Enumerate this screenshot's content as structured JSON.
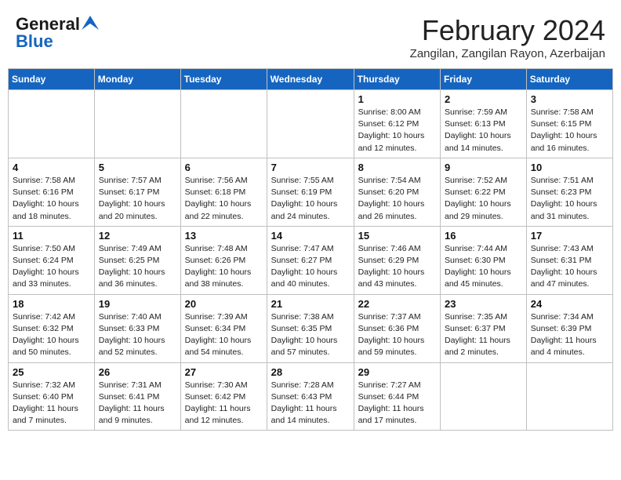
{
  "logo": {
    "line1": "General",
    "line2": "Blue"
  },
  "title": "February 2024",
  "subtitle": "Zangilan, Zangilan Rayon, Azerbaijan",
  "days_header": [
    "Sunday",
    "Monday",
    "Tuesday",
    "Wednesday",
    "Thursday",
    "Friday",
    "Saturday"
  ],
  "weeks": [
    [
      {
        "num": "",
        "info": ""
      },
      {
        "num": "",
        "info": ""
      },
      {
        "num": "",
        "info": ""
      },
      {
        "num": "",
        "info": ""
      },
      {
        "num": "1",
        "info": "Sunrise: 8:00 AM\nSunset: 6:12 PM\nDaylight: 10 hours\nand 12 minutes."
      },
      {
        "num": "2",
        "info": "Sunrise: 7:59 AM\nSunset: 6:13 PM\nDaylight: 10 hours\nand 14 minutes."
      },
      {
        "num": "3",
        "info": "Sunrise: 7:58 AM\nSunset: 6:15 PM\nDaylight: 10 hours\nand 16 minutes."
      }
    ],
    [
      {
        "num": "4",
        "info": "Sunrise: 7:58 AM\nSunset: 6:16 PM\nDaylight: 10 hours\nand 18 minutes."
      },
      {
        "num": "5",
        "info": "Sunrise: 7:57 AM\nSunset: 6:17 PM\nDaylight: 10 hours\nand 20 minutes."
      },
      {
        "num": "6",
        "info": "Sunrise: 7:56 AM\nSunset: 6:18 PM\nDaylight: 10 hours\nand 22 minutes."
      },
      {
        "num": "7",
        "info": "Sunrise: 7:55 AM\nSunset: 6:19 PM\nDaylight: 10 hours\nand 24 minutes."
      },
      {
        "num": "8",
        "info": "Sunrise: 7:54 AM\nSunset: 6:20 PM\nDaylight: 10 hours\nand 26 minutes."
      },
      {
        "num": "9",
        "info": "Sunrise: 7:52 AM\nSunset: 6:22 PM\nDaylight: 10 hours\nand 29 minutes."
      },
      {
        "num": "10",
        "info": "Sunrise: 7:51 AM\nSunset: 6:23 PM\nDaylight: 10 hours\nand 31 minutes."
      }
    ],
    [
      {
        "num": "11",
        "info": "Sunrise: 7:50 AM\nSunset: 6:24 PM\nDaylight: 10 hours\nand 33 minutes."
      },
      {
        "num": "12",
        "info": "Sunrise: 7:49 AM\nSunset: 6:25 PM\nDaylight: 10 hours\nand 36 minutes."
      },
      {
        "num": "13",
        "info": "Sunrise: 7:48 AM\nSunset: 6:26 PM\nDaylight: 10 hours\nand 38 minutes."
      },
      {
        "num": "14",
        "info": "Sunrise: 7:47 AM\nSunset: 6:27 PM\nDaylight: 10 hours\nand 40 minutes."
      },
      {
        "num": "15",
        "info": "Sunrise: 7:46 AM\nSunset: 6:29 PM\nDaylight: 10 hours\nand 43 minutes."
      },
      {
        "num": "16",
        "info": "Sunrise: 7:44 AM\nSunset: 6:30 PM\nDaylight: 10 hours\nand 45 minutes."
      },
      {
        "num": "17",
        "info": "Sunrise: 7:43 AM\nSunset: 6:31 PM\nDaylight: 10 hours\nand 47 minutes."
      }
    ],
    [
      {
        "num": "18",
        "info": "Sunrise: 7:42 AM\nSunset: 6:32 PM\nDaylight: 10 hours\nand 50 minutes."
      },
      {
        "num": "19",
        "info": "Sunrise: 7:40 AM\nSunset: 6:33 PM\nDaylight: 10 hours\nand 52 minutes."
      },
      {
        "num": "20",
        "info": "Sunrise: 7:39 AM\nSunset: 6:34 PM\nDaylight: 10 hours\nand 54 minutes."
      },
      {
        "num": "21",
        "info": "Sunrise: 7:38 AM\nSunset: 6:35 PM\nDaylight: 10 hours\nand 57 minutes."
      },
      {
        "num": "22",
        "info": "Sunrise: 7:37 AM\nSunset: 6:36 PM\nDaylight: 10 hours\nand 59 minutes."
      },
      {
        "num": "23",
        "info": "Sunrise: 7:35 AM\nSunset: 6:37 PM\nDaylight: 11 hours\nand 2 minutes."
      },
      {
        "num": "24",
        "info": "Sunrise: 7:34 AM\nSunset: 6:39 PM\nDaylight: 11 hours\nand 4 minutes."
      }
    ],
    [
      {
        "num": "25",
        "info": "Sunrise: 7:32 AM\nSunset: 6:40 PM\nDaylight: 11 hours\nand 7 minutes."
      },
      {
        "num": "26",
        "info": "Sunrise: 7:31 AM\nSunset: 6:41 PM\nDaylight: 11 hours\nand 9 minutes."
      },
      {
        "num": "27",
        "info": "Sunrise: 7:30 AM\nSunset: 6:42 PM\nDaylight: 11 hours\nand 12 minutes."
      },
      {
        "num": "28",
        "info": "Sunrise: 7:28 AM\nSunset: 6:43 PM\nDaylight: 11 hours\nand 14 minutes."
      },
      {
        "num": "29",
        "info": "Sunrise: 7:27 AM\nSunset: 6:44 PM\nDaylight: 11 hours\nand 17 minutes."
      },
      {
        "num": "",
        "info": ""
      },
      {
        "num": "",
        "info": ""
      }
    ]
  ]
}
